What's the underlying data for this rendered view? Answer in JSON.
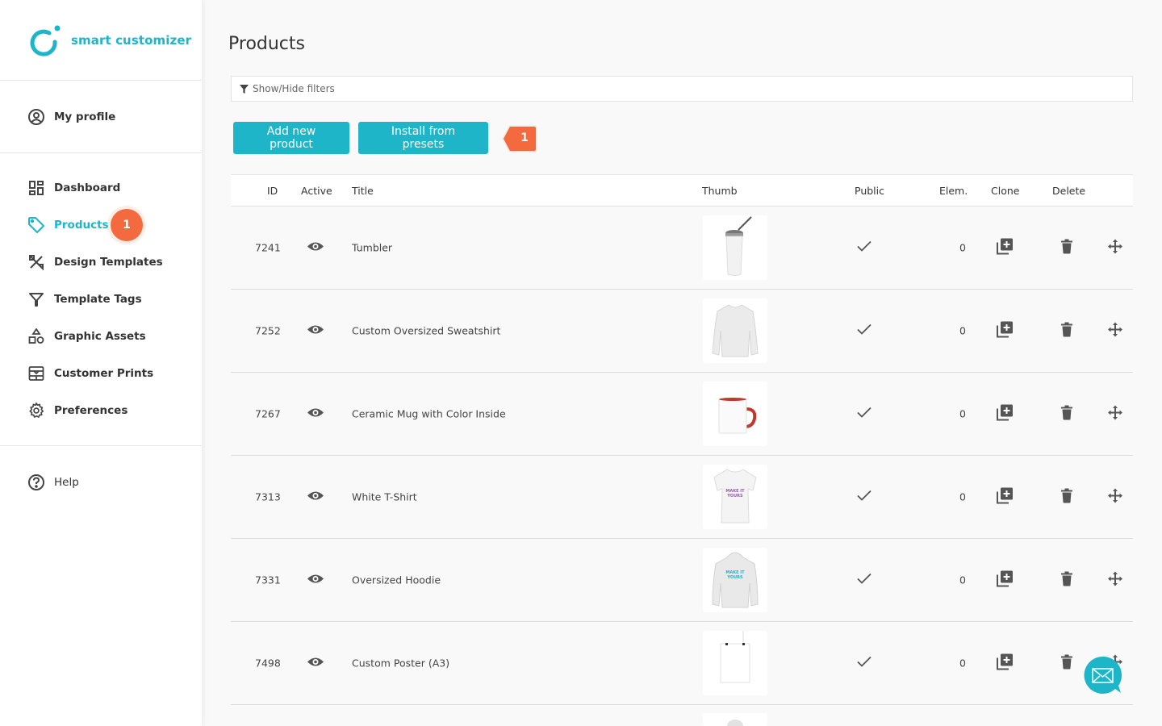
{
  "brand": {
    "name": "smart customizer",
    "accent": "#1fb5c9",
    "badge_color": "#f26a3d"
  },
  "sidebar": {
    "profile": {
      "label": "My profile",
      "icon": "user-circle-icon"
    },
    "items": [
      {
        "label": "Dashboard",
        "icon": "dashboard-icon",
        "active": false
      },
      {
        "label": "Products",
        "icon": "tag-icon",
        "active": true,
        "badge": "1"
      },
      {
        "label": "Design Templates",
        "icon": "design-tools-icon",
        "active": false
      },
      {
        "label": "Template Tags",
        "icon": "filter-icon",
        "active": false
      },
      {
        "label": "Graphic Assets",
        "icon": "shapes-icon",
        "active": false
      },
      {
        "label": "Customer Prints",
        "icon": "prints-icon",
        "active": false
      },
      {
        "label": "Preferences",
        "icon": "gear-icon",
        "active": false
      }
    ],
    "help": {
      "label": "Help",
      "icon": "help-circle-icon"
    }
  },
  "main": {
    "title": "Products",
    "filters_label": "Show/Hide filters",
    "buttons": {
      "add": "Add new product",
      "install": "Install from presets"
    },
    "step_badge": "1",
    "table": {
      "headers": {
        "id": "ID",
        "active": "Active",
        "title": "Title",
        "thumb": "Thumb",
        "public": "Public",
        "elem": "Elem.",
        "clone": "Clone",
        "delete": "Delete"
      },
      "rows": [
        {
          "id": "7241",
          "title": "Tumbler",
          "thumb": "tumbler",
          "public": true,
          "elem": "0"
        },
        {
          "id": "7252",
          "title": "Custom Oversized Sweatshirt",
          "thumb": "sweatshirt",
          "public": true,
          "elem": "0"
        },
        {
          "id": "7267",
          "title": "Ceramic Mug with Color Inside",
          "thumb": "mug",
          "public": true,
          "elem": "0"
        },
        {
          "id": "7313",
          "title": "White T-Shirt",
          "thumb": "tshirt",
          "public": true,
          "elem": "0"
        },
        {
          "id": "7331",
          "title": "Oversized Hoodie",
          "thumb": "hoodie",
          "public": true,
          "elem": "0"
        },
        {
          "id": "7498",
          "title": "Custom Poster (A3)",
          "thumb": "poster",
          "public": true,
          "elem": "0"
        }
      ]
    }
  },
  "chat": {
    "icon": "mail-icon"
  }
}
